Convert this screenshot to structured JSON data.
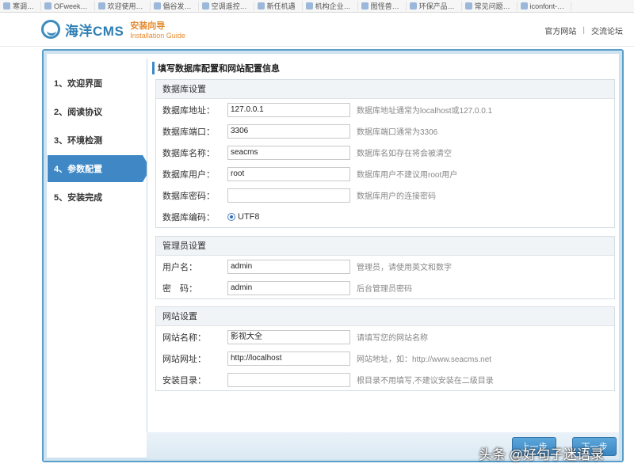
{
  "bookmarks": [
    "寒调…",
    "OFweek…",
    "欢迎使用…",
    "倡谷发…",
    "空调遥控…",
    "新任机遇",
    "机构企业…",
    "图怪兽…",
    "环保产品…",
    "常见问题…",
    "iconfont-…"
  ],
  "header": {
    "logo_text": "海洋CMS",
    "logo_sub_cn": "安装向导",
    "logo_sub_en": "Installation Guide",
    "links": [
      "官方网站",
      "交流论坛"
    ],
    "link_sep": "|"
  },
  "steps": [
    {
      "label": "1、欢迎界面",
      "active": false
    },
    {
      "label": "2、阅读协议",
      "active": false
    },
    {
      "label": "3、环境检测",
      "active": false
    },
    {
      "label": "4、参数配置",
      "active": true
    },
    {
      "label": "5、安装完成",
      "active": false
    }
  ],
  "content": {
    "title": "填写数据库配置和网站配置信息",
    "db": {
      "head": "数据库设置",
      "host_label": "数据库地址：",
      "host_value": "127.0.0.1",
      "host_hint": "数据库地址通常为localhost或127.0.0.1",
      "port_label": "数据库端口：",
      "port_value": "3306",
      "port_hint": "数据库端口通常为3306",
      "name_label": "数据库名称：",
      "name_value": "seacms",
      "name_hint": "数据库名如存在将会被清空",
      "user_label": "数据库用户：",
      "user_value": "root",
      "user_hint": "数据库用户不建议用root用户",
      "pass_label": "数据库密码：",
      "pass_value": "",
      "pass_hint": "数据库用户的连接密码",
      "charset_label": "数据库编码：",
      "charset_value": "UTF8"
    },
    "admin": {
      "head": "管理员设置",
      "user_label": "用户名：",
      "user_value": "admin",
      "user_hint": "管理员，请使用英文和数字",
      "pass_label": "密　码：",
      "pass_value": "admin",
      "pass_hint": "后台管理员密码"
    },
    "site": {
      "head": "网站设置",
      "name_label": "网站名称：",
      "name_value": "影视大全",
      "name_hint": "请填写您的网站名称",
      "url_label": "网站网址：",
      "url_value": "http://localhost",
      "url_hint": "网站地址，如：http://www.seacms.net",
      "dir_label": "安装目录：",
      "dir_value": "",
      "dir_hint": "根目录不用填写,不建议安装在二级目录"
    }
  },
  "buttons": {
    "prev": "上一步",
    "next": "下一步"
  },
  "watermark": "头条 @好句子迷语录",
  "colors": {
    "accent": "#3f88c5",
    "frame": "#5b9ec9",
    "logo": "#2f7fb4",
    "logo_sub": "#e58a2e"
  }
}
